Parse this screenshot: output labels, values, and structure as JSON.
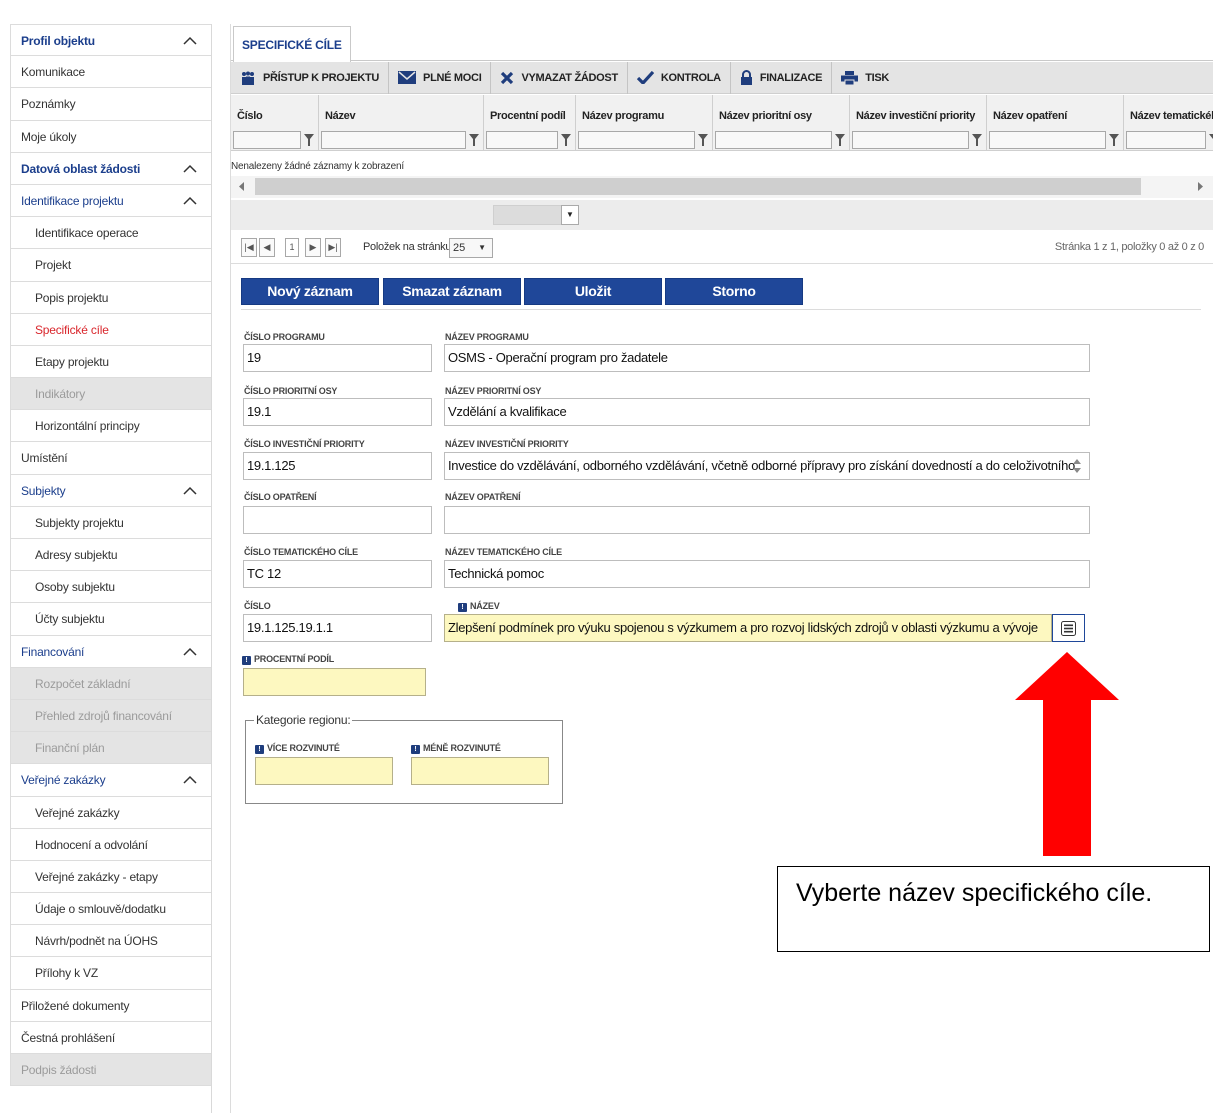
{
  "sidebar": {
    "items": [
      {
        "label": "Profil objektu",
        "kind": "head",
        "chevron": true
      },
      {
        "label": "Komunikace",
        "kind": "normal"
      },
      {
        "label": "Poznámky",
        "kind": "normal"
      },
      {
        "label": "Moje úkoly",
        "kind": "normal"
      },
      {
        "label": "Datová oblast žádosti",
        "kind": "head",
        "chevron": true
      },
      {
        "label": "Identifikace projektu",
        "kind": "blue",
        "chevron": true
      },
      {
        "label": "Identifikace operace",
        "kind": "sub"
      },
      {
        "label": "Projekt",
        "kind": "sub"
      },
      {
        "label": "Popis projektu",
        "kind": "sub"
      },
      {
        "label": "Specifické cíle",
        "kind": "active"
      },
      {
        "label": "Etapy projektu",
        "kind": "sub"
      },
      {
        "label": "Indikátory",
        "kind": "disabled-sub"
      },
      {
        "label": "Horizontální principy",
        "kind": "sub"
      },
      {
        "label": "Umístění",
        "kind": "normal"
      },
      {
        "label": "Subjekty",
        "kind": "blue",
        "chevron": true
      },
      {
        "label": "Subjekty projektu",
        "kind": "sub"
      },
      {
        "label": "Adresy subjektu",
        "kind": "sub"
      },
      {
        "label": "Osoby subjektu",
        "kind": "sub"
      },
      {
        "label": "Účty subjektu",
        "kind": "sub"
      },
      {
        "label": "Financování",
        "kind": "blue",
        "chevron": true
      },
      {
        "label": "Rozpočet základní",
        "kind": "disabled-sub"
      },
      {
        "label": "Přehled zdrojů financování",
        "kind": "disabled-sub"
      },
      {
        "label": "Finanční plán",
        "kind": "disabled-sub"
      },
      {
        "label": "Veřejné zakázky",
        "kind": "blue",
        "chevron": true
      },
      {
        "label": "Veřejné zakázky",
        "kind": "sub"
      },
      {
        "label": "Hodnocení a odvolání",
        "kind": "sub"
      },
      {
        "label": "Veřejné zakázky - etapy",
        "kind": "sub"
      },
      {
        "label": "Údaje o smlouvě/dodatku",
        "kind": "sub"
      },
      {
        "label": "Návrh/podnět na ÚOHS",
        "kind": "sub"
      },
      {
        "label": "Přílohy k VZ",
        "kind": "sub"
      },
      {
        "label": "Přiložené dokumenty",
        "kind": "normal"
      },
      {
        "label": "Čestná prohlášení",
        "kind": "normal"
      },
      {
        "label": "Podpis žádosti",
        "kind": "disabled"
      }
    ]
  },
  "tab": {
    "label": "SPECIFICKÉ CÍLE"
  },
  "toolbar": {
    "access_label": "PŘÍSTUP K PROJEKTU",
    "powers_label": "PLNÉ MOCI",
    "delete_label": "VYMAZAT ŽÁDOST",
    "check_label": "KONTROLA",
    "finalize_label": "FINALIZACE",
    "print_label": "TISK"
  },
  "grid": {
    "columns": [
      "Číslo",
      "Název",
      "Procentní podíl",
      "Název programu",
      "Název prioritní osy",
      "Název investiční priority",
      "Název opatření",
      "Název tematického"
    ],
    "empty_message": "Nenalezeny žádné záznamy k zobrazení"
  },
  "pager": {
    "first": "|◀",
    "prev": "◀",
    "current_page": "1",
    "next": "▶",
    "last": "▶|",
    "items_per_page_label": "Položek na stránku",
    "page_size": "25",
    "info": "Stránka 1 z 1, položky 0 až 0 z 0"
  },
  "actions": {
    "new_label": "Nový záznam",
    "delete_label": "Smazat záznam",
    "save_label": "Uložit",
    "cancel_label": "Storno"
  },
  "form": {
    "program_number_label": "ČÍSLO PROGRAMU",
    "program_number": "19",
    "program_name_label": "NÁZEV PROGRAMU",
    "program_name": "OSMS - Operační program pro žadatele",
    "axis_number_label": "ČÍSLO PRIORITNÍ OSY",
    "axis_number": "19.1",
    "axis_name_label": "NÁZEV PRIORITNÍ OSY",
    "axis_name": "Vzdělání a kvalifikace",
    "invest_number_label": "ČÍSLO INVESTIČNÍ PRIORITY",
    "invest_number": "19.1.125",
    "invest_name_label": "NÁZEV INVESTIČNÍ PRIORITY",
    "invest_name": "Investice do vzdělávání, odborného vzdělávání, včetně odborné přípravy pro získání dovedností a do celoživotního",
    "measure_number_label": "ČÍSLO OPATŘENÍ",
    "measure_number": "",
    "measure_name_label": "NÁZEV OPATŘENÍ",
    "measure_name": "",
    "theme_number_label": "ČÍSLO TEMATICKÉHO CÍLE",
    "theme_number": "TC 12",
    "theme_name_label": "NÁZEV TEMATICKÉHO CÍLE",
    "theme_name": "Technická pomoc",
    "number_label": "ČÍSLO",
    "number": "19.1.125.19.1.1",
    "name_label": "NÁZEV",
    "name": "Zlepšení podmínek pro výuku spojenou s výzkumem a pro rozvoj lidských zdrojů v oblasti výzkumu a vývoje",
    "share_label": "PROCENTNÍ PODÍL",
    "share": "",
    "region_legend": "Kategorie regionu:",
    "more_developed_label": "VÍCE ROZVINUTÉ",
    "more_developed": "",
    "less_developed_label": "MÉNĚ ROZVINUTÉ",
    "less_developed": ""
  },
  "required_marker": "!",
  "callout": {
    "text": "Vyberte název specifického cíle."
  },
  "colors": {
    "primary": "#1f4799",
    "active_link": "#d9262c",
    "required_bg": "#fdf8c0",
    "arrow": "#ff0000"
  }
}
